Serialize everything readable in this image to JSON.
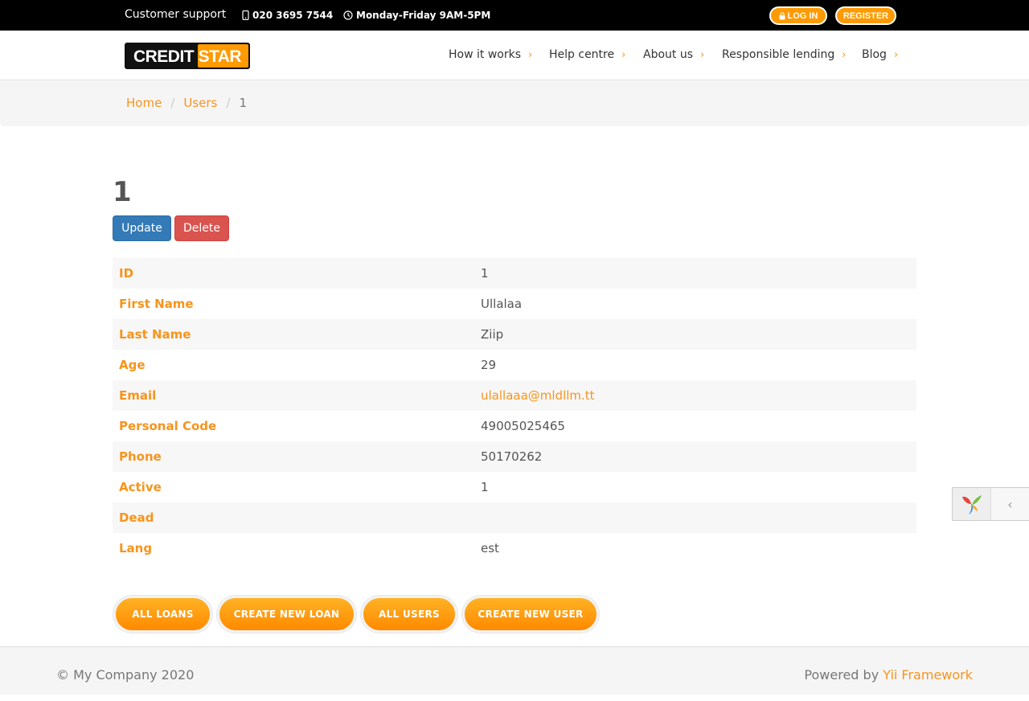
{
  "topbar": {
    "support": "Customer support",
    "phone": "020 3695 7544",
    "hours": "Monday-Friday 9AM-5PM",
    "login": "LOG IN",
    "register": "REGISTER"
  },
  "header": {
    "logo_text": "CREDIT STAR",
    "nav": [
      "How it works",
      "Help centre",
      "About us",
      "Responsible lending",
      "Blog"
    ]
  },
  "breadcrumb": {
    "home": "Home",
    "users": "Users",
    "current": "1"
  },
  "main": {
    "title": "1",
    "update_label": "Update",
    "delete_label": "Delete",
    "rows": [
      {
        "label": "ID",
        "value": "1"
      },
      {
        "label": "First Name",
        "value": "Ullalaa"
      },
      {
        "label": "Last Name",
        "value": "Ziip"
      },
      {
        "label": "Age",
        "value": "29"
      },
      {
        "label": "Email",
        "value": "ulallaaa@mldllm.tt"
      },
      {
        "label": "Personal Code",
        "value": "49005025465"
      },
      {
        "label": "Phone",
        "value": "50170262"
      },
      {
        "label": "Active",
        "value": "1"
      },
      {
        "label": "Dead",
        "value": ""
      },
      {
        "label": "Lang",
        "value": "est"
      }
    ],
    "actions": [
      "ALL LOANS",
      "CREATE NEW LOAN",
      "ALL USERS",
      "CREATE NEW USER"
    ]
  },
  "footer": {
    "copyright": "© My Company 2020",
    "powered_prefix": "Powered by ",
    "powered_link": "Yii Framework"
  },
  "colors": {
    "accent": "#f7941d",
    "update_button": "#337ab7",
    "delete_button": "#d9534f"
  },
  "icons": {
    "phone": "mobile-phone-icon",
    "hours": "clock-icon",
    "login": "lock-icon",
    "nav": "chevron-right-icon",
    "debug_logo": "yii-logo-icon",
    "debug_toggle": "chevron-left-icon"
  }
}
